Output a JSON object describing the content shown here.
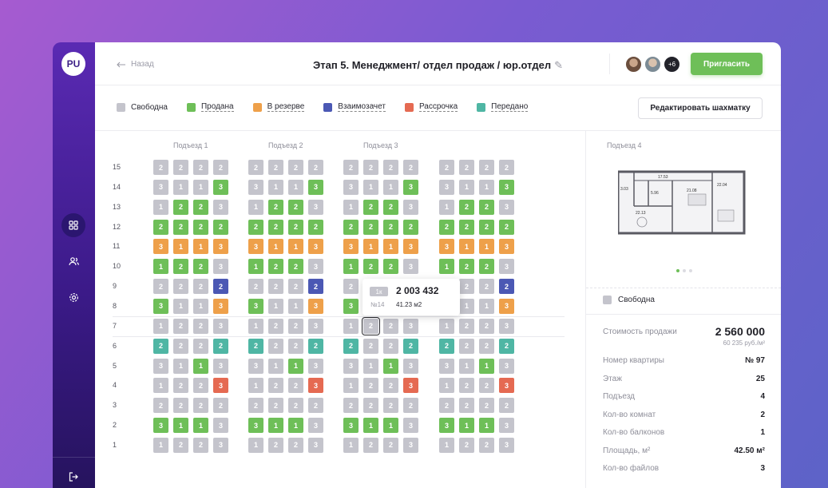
{
  "logo": "PU",
  "header": {
    "back": "Назад",
    "title": "Этап 5. Менеджмент/ отдел продаж / юр.отдел",
    "avatars_more": "+6",
    "invite": "Пригласить"
  },
  "legend": [
    {
      "label": "Свободна",
      "status": "free"
    },
    {
      "label": "Продана",
      "status": "sold"
    },
    {
      "label": "В резерве",
      "status": "reserve"
    },
    {
      "label": "Взаимозачет",
      "status": "barter"
    },
    {
      "label": "Рассрочка",
      "status": "install"
    },
    {
      "label": "Передано",
      "status": "transfer"
    }
  ],
  "edit_button": "Редактировать шахматку",
  "entrances": [
    "Подъезд 1",
    "Подъезд 2",
    "Подъезд 3"
  ],
  "floors": [
    "15",
    "14",
    "13",
    "12",
    "11",
    "10",
    "9",
    "8",
    "7",
    "6",
    "5",
    "4",
    "3",
    "2",
    "1"
  ],
  "grid": {
    "15": {
      "rooms": "2222",
      "status": "FFFF"
    },
    "14": {
      "rooms": "3113",
      "status": "FFFS"
    },
    "13": {
      "rooms": "1223",
      "status": "FSSF"
    },
    "12": {
      "rooms": "2222",
      "status": "SSSS"
    },
    "11": {
      "rooms": "3113",
      "status": "RRRR"
    },
    "10": {
      "rooms": "1223",
      "status": "SSSF"
    },
    "9": {
      "rooms": "2222",
      "status": "FFFB"
    },
    "8": {
      "rooms": "3113",
      "status": "SFFR"
    },
    "7": {
      "rooms": "1223",
      "status": "FFFF"
    },
    "6": {
      "rooms": "2222",
      "status": "TFFT"
    },
    "5": {
      "rooms": "3113",
      "status": "FFSF"
    },
    "4": {
      "rooms": "1223",
      "status": "FFFI"
    },
    "3": {
      "rooms": "2222",
      "status": "FFFF"
    },
    "2": {
      "rooms": "3113",
      "status": "SSSF"
    },
    "1": {
      "rooms": "1223",
      "status": "FFFF"
    }
  },
  "colors": {
    "free": "#c4c4cc",
    "sold": "#6ebf58",
    "reserve": "#eea04a",
    "barter": "#4b58b4",
    "install": "#e56a52",
    "transfer": "#4fb6a4"
  },
  "tooltip": {
    "badge": "1к",
    "price": "2 003 432",
    "number": "№14",
    "area": "41.23 м2"
  },
  "panel": {
    "entrance": "Подъезд 4",
    "plan_labels": [
      "17.53",
      "3.03",
      "5.96",
      "21.08",
      "22.04",
      "22.13"
    ],
    "status": "Свободна",
    "price_label": "Стоимость продажи",
    "price": "2 560 000",
    "price_m2": "60 235 руб./м²",
    "rows": [
      {
        "k": "Номер квартиры",
        "v": "№ 97"
      },
      {
        "k": "Этаж",
        "v": "25"
      },
      {
        "k": "Подъезд",
        "v": "4"
      },
      {
        "k": "Кол-во комнат",
        "v": "2"
      },
      {
        "k": "Кол-во балконов",
        "v": "1"
      },
      {
        "k": "Площадь, м²",
        "v": "42.50 м²"
      },
      {
        "k": "Кол-во файлов",
        "v": "3"
      }
    ]
  }
}
